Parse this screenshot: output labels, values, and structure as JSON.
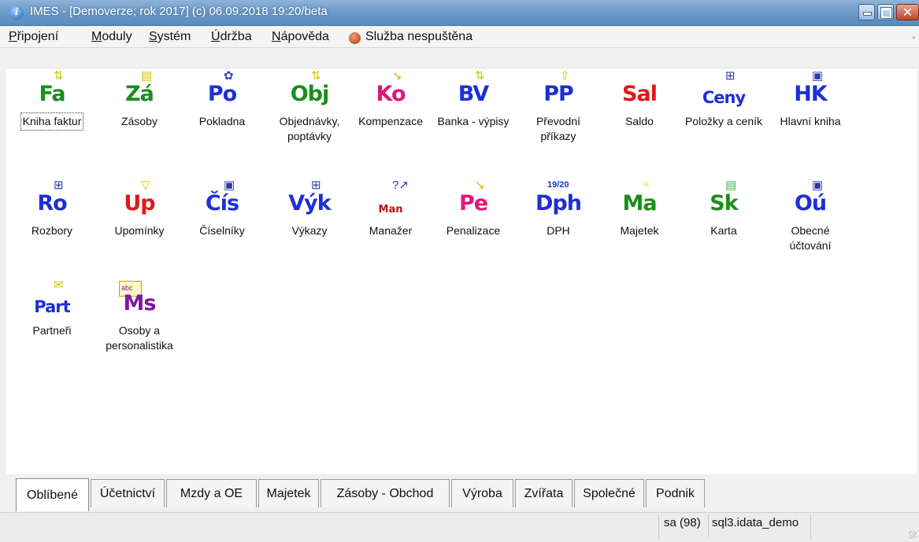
{
  "window": {
    "title": "IMES - [Demoverze;  rok 2017] (c) 06.09.2018 19:20/beta",
    "app_icon": "i"
  },
  "menu": {
    "items": [
      {
        "underline": "P",
        "rest": "řipojení"
      },
      {
        "underline": "M",
        "rest": "oduly"
      },
      {
        "underline": "S",
        "rest": "ystém"
      },
      {
        "underline": "Ú",
        "rest": "držba"
      },
      {
        "underline": "N",
        "rest": "ápověda"
      }
    ],
    "status_text": "Služba nespuštěna"
  },
  "tiles": [
    {
      "abbr": "Fa",
      "color": "#1a8f1a",
      "decor": "⇅",
      "decor_color": "#c9c900",
      "label": "Kniha faktur"
    },
    {
      "abbr": "Zá",
      "color": "#1a8f1a",
      "decor": "▤",
      "decor_color": "#c9c900",
      "label": "Zásoby"
    },
    {
      "abbr": "Po",
      "color": "#1d2fd6",
      "decor": "✿",
      "decor_color": "#3340b8",
      "label": "Pokladna"
    },
    {
      "abbr": "Obj",
      "color": "#1a8f1a",
      "decor": "⇅",
      "decor_color": "#c9c900",
      "label": "Objednávky, poptávky"
    },
    {
      "abbr": "Ko",
      "color": "#e0187a",
      "decor": "↘",
      "decor_color": "#e0b000",
      "label": "Kompenzace"
    },
    {
      "abbr": "BV",
      "color": "#1d2fd6",
      "decor": "⇅",
      "decor_color": "#c9c900",
      "label": "Banka - výpisy"
    },
    {
      "abbr": "PP",
      "color": "#1d2fd6",
      "decor": "⇧",
      "decor_color": "#c9c900",
      "label": "Převodní příkazy"
    },
    {
      "abbr": "Sal",
      "color": "#e01818",
      "decor": "",
      "decor_color": "#c9c900",
      "label": "Saldo"
    },
    {
      "abbr": "Ceny",
      "color": "#1d2fd6",
      "decor": "⊞",
      "decor_color": "#2a3aa8",
      "label": "Položky a ceník"
    },
    {
      "abbr": "HK",
      "color": "#1d2fd6",
      "decor": "▣",
      "decor_color": "#2a3aa8",
      "label": "Hlavní kniha"
    },
    {
      "abbr": "Ro",
      "color": "#1d2fd6",
      "decor": "⊞",
      "decor_color": "#2a3aa8",
      "label": "Rozbory"
    },
    {
      "abbr": "Up",
      "color": "#e01818",
      "decor": "▽",
      "decor_color": "#d8c000",
      "label": "Upomínky"
    },
    {
      "abbr": "Čís",
      "color": "#1d2fd6",
      "decor": "▣",
      "decor_color": "#2a3aa8",
      "label": "Číselníky"
    },
    {
      "abbr": "Výk",
      "color": "#1d2fd6",
      "decor": "⊞",
      "decor_color": "#2a3aa8",
      "label": "Výkazy"
    },
    {
      "abbr": "Man",
      "color": "#c01010",
      "decor": "?↗",
      "decor_color": "#2a3aa8",
      "label": "Manažer"
    },
    {
      "abbr": "Pe",
      "color": "#e0187a",
      "decor": "↘",
      "decor_color": "#e0b000",
      "label": "Penalizace"
    },
    {
      "abbr": "Dph",
      "color": "#1d2fd6",
      "decor": "19/20",
      "decor_color": "#1d2fd6",
      "label": "DPH"
    },
    {
      "abbr": "Ma",
      "color": "#1a8f1a",
      "decor": "☀",
      "decor_color": "#f0e890",
      "label": "Majetek"
    },
    {
      "abbr": "Sk",
      "color": "#1a8f1a",
      "decor": "▤",
      "decor_color": "#4caf50",
      "label": "Karta"
    },
    {
      "abbr": "Oú",
      "color": "#1d2fd6",
      "decor": "▣",
      "decor_color": "#2a3aa8",
      "label": "Obecné účtování"
    },
    {
      "abbr": "Part",
      "color": "#1d2fd6",
      "decor": "✉",
      "decor_color": "#c9c900",
      "label": "Partneři"
    },
    {
      "abbr": "Ms",
      "color": "#7a1aa0",
      "decor": "abc",
      "decor_color": "#7a1aa0",
      "label": "Osoby a personalistika"
    }
  ],
  "tabs": [
    "Oblíbené",
    "Účetnictví",
    "Mzdy a OE",
    "Majetek",
    "Zásoby - Obchod",
    "Výroba",
    "Zvířata",
    "Společné",
    "Podnik"
  ],
  "active_tab": "Oblíbené",
  "statusbar": {
    "user": "sa (98)",
    "database": "sql3.idata_demo"
  }
}
